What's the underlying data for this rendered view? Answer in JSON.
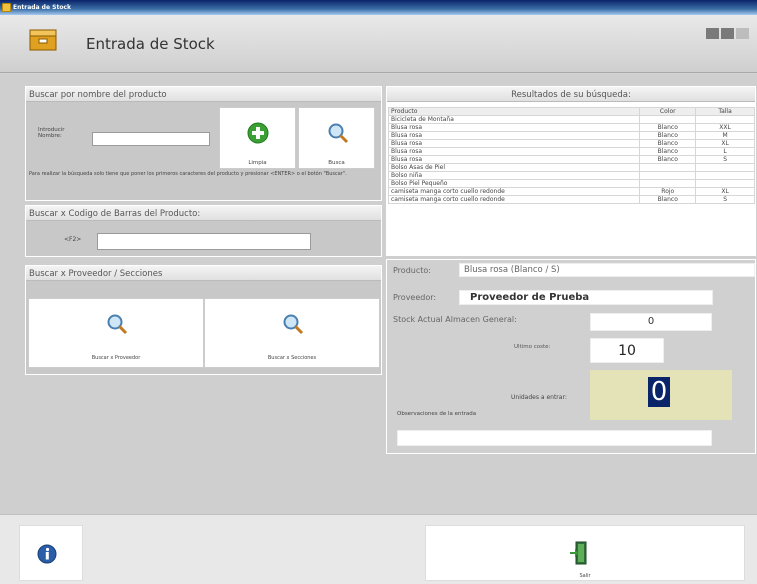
{
  "window": {
    "title": "Entrada de Stock"
  },
  "header": {
    "title": "Entrada de Stock"
  },
  "search_name": {
    "title": "Buscar por nombre del producto",
    "input_label": "Introducir Nombre:",
    "input_value": "",
    "clear_label": "Limpia",
    "search_label": "Busca",
    "help_text": "Para realizar la búsqueda solo tiene que poner los primeros caracteres del producto y presionar <ENTER> o el botón \"Buscar\"."
  },
  "search_barcode": {
    "title": "Buscar x Codigo de Barras del Producto:",
    "key_label": "<F2>",
    "input_value": ""
  },
  "search_supplier": {
    "title": "Buscar x Proveedor / Secciones",
    "supplier_button": "Buscar x Proveedor",
    "sections_button": "Buscar x Secciones"
  },
  "results": {
    "title": "Resultados de su búsqueda:",
    "columns": [
      "Producto",
      "Color",
      "Talla"
    ],
    "rows": [
      [
        "Bicicleta de Montaña",
        "",
        ""
      ],
      [
        "Blusa rosa",
        "Blanco",
        "XXL"
      ],
      [
        "Blusa rosa",
        "Blanco",
        "M"
      ],
      [
        "Blusa rosa",
        "Blanco",
        "XL"
      ],
      [
        "Blusa rosa",
        "Blanco",
        "L"
      ],
      [
        "Blusa rosa",
        "Blanco",
        "S"
      ],
      [
        "Bolso Asas de Piel",
        "",
        ""
      ],
      [
        "Bolso niña",
        "",
        ""
      ],
      [
        "Bolso Piel Pequeño",
        "",
        ""
      ],
      [
        "camiseta manga corto cuello redonde",
        "Rojo",
        "XL"
      ],
      [
        "camiseta manga corto cuello redonde",
        "Blanco",
        "S"
      ]
    ]
  },
  "detail": {
    "product_label": "Producto:",
    "product_value": "Blusa rosa (Blanco / S)",
    "supplier_label": "Proveedor:",
    "supplier_value": "Proveedor de Prueba",
    "stock_label": "Stock Actual Almacen General:",
    "stock_value": "0",
    "last_cut_label": "Ultimo coste:",
    "last_cut_value": "10",
    "units_label": "Unidades a entrar:",
    "units_value": "0",
    "notes_label": "Observaciones de la entrada",
    "notes_value": ""
  },
  "footer": {
    "exit_label": "Salir"
  },
  "colors": {
    "accent": "#0a246a",
    "highlight": "#e4e3b8",
    "units_bg": "#0a246a"
  }
}
